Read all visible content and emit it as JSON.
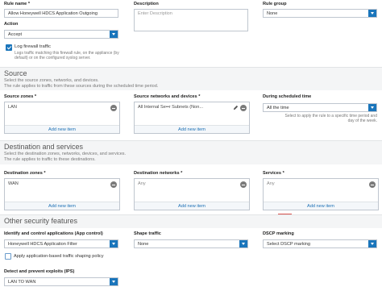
{
  "rule_name": {
    "label": "Rule name *",
    "value": "Allow Honeywell HDCS Application Outgoing"
  },
  "description": {
    "label": "Description",
    "placeholder": "Enter Description"
  },
  "rule_group": {
    "label": "Rule group",
    "value": "None"
  },
  "action": {
    "label": "Action",
    "value": "Accept"
  },
  "log_traffic": {
    "label": "Log firewall traffic",
    "hint_line1": "Logs traffic matching this firewall rule, on the appliance (by",
    "hint_line2": "default) or on the configured syslog server."
  },
  "source": {
    "title": "Source",
    "sub_line1": "Select the source zones, networks, and devices.",
    "sub_line2": "The rule applies to traffic from these sources during the scheduled time period.",
    "zones_label": "Source zones *",
    "zones_item": "LAN",
    "zones_add": "Add new item",
    "networks_label": "Source networks and devices *",
    "networks_item": "All Internal Se••r Subnets (Non...",
    "networks_add": "Add new item",
    "schedule_label": "During scheduled time",
    "schedule_value": "All the time",
    "schedule_hint_line1": "Select to apply the rule to a specific time period and",
    "schedule_hint_line2": "day of the week."
  },
  "destination": {
    "title": "Destination and services",
    "sub_line1": "Select the destination zones, networks, devices, and services.",
    "sub_line2": "The rule applies to traffic to these destinations.",
    "zones_label": "Destination zones *",
    "zones_item": "WAN",
    "zones_add": "Add new item",
    "networks_label": "Destination networks *",
    "networks_item": "Any",
    "networks_add": "Add new item",
    "services_label": "Services *",
    "services_item": "Any",
    "services_add": "Add new item"
  },
  "other": {
    "title": "Other security features",
    "app_control_label": "Identify and control applications (App control)",
    "app_control_value": "Honeywell HDCS Application Filter",
    "shaping_checkbox_label": "Apply application-based traffic shaping policy",
    "shape_traffic_label": "Shape traffic",
    "shape_traffic_value": "None",
    "dscp_label": "DSCP marking",
    "dscp_value": "Select DSCP marking",
    "ips_label": "Detect and prevent exploits (IPS)",
    "ips_value": "LAN TO WAN"
  },
  "colors": {
    "accent": "#1a75bb",
    "section_bg": "#f4f5f6",
    "link": "#1a6fb5",
    "danger": "#d9534f"
  },
  "icons": [
    "dropdown-icon",
    "remove-icon",
    "edit-icon",
    "checkbox-icon"
  ]
}
